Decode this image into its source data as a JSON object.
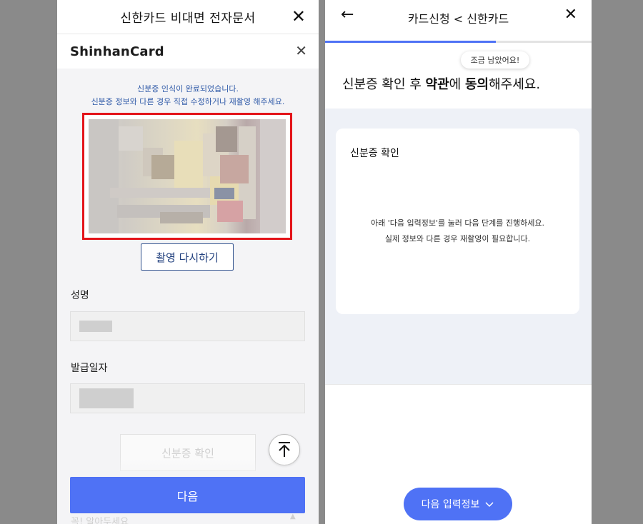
{
  "left": {
    "topbar": {
      "title": "신한카드 비대면 전자문서",
      "close_icon": "close-icon"
    },
    "brand": {
      "logo_text": "ShinhanCard"
    },
    "notice": {
      "line1": "신분증 인식이 완료되었습니다.",
      "line2": "신분증 정보와 다른 경우 직접 수정하거나 재촬영 해주세요."
    },
    "retake_label": "촬영 다시하기",
    "fields": {
      "name_label": "성명",
      "issue_date_label": "발급일자"
    },
    "id_check_label": "신분증 확인",
    "next_label": "다음",
    "hint_label": "꼭! 알아두세요",
    "colors": {
      "accent": "#4f72f5",
      "highlight_border": "#e3141a",
      "notice_text": "#2f5aa8"
    }
  },
  "right": {
    "topbar": {
      "title": "카드신청 < 신한카드",
      "back_icon": "arrow-left-icon",
      "close_icon": "close-icon"
    },
    "progress": {
      "fraction": 0.64
    },
    "bubble_text": "조금 남았어요!",
    "heading": {
      "part1": "신분증 확인 후 ",
      "part2": "약관",
      "part3": "에 ",
      "part4": "동의",
      "part5": "해주세요."
    },
    "card": {
      "title": "신분증 확인",
      "message_line1": "아래 '다음 입력정보'를 눌러 다음 단계를 진행하세요.",
      "message_line2": "실제 정보와 다른 경우 재촬영이 필요합니다."
    },
    "next_info_label": "다음 입력정보",
    "next_info_icon": "chevron-down-icon"
  }
}
